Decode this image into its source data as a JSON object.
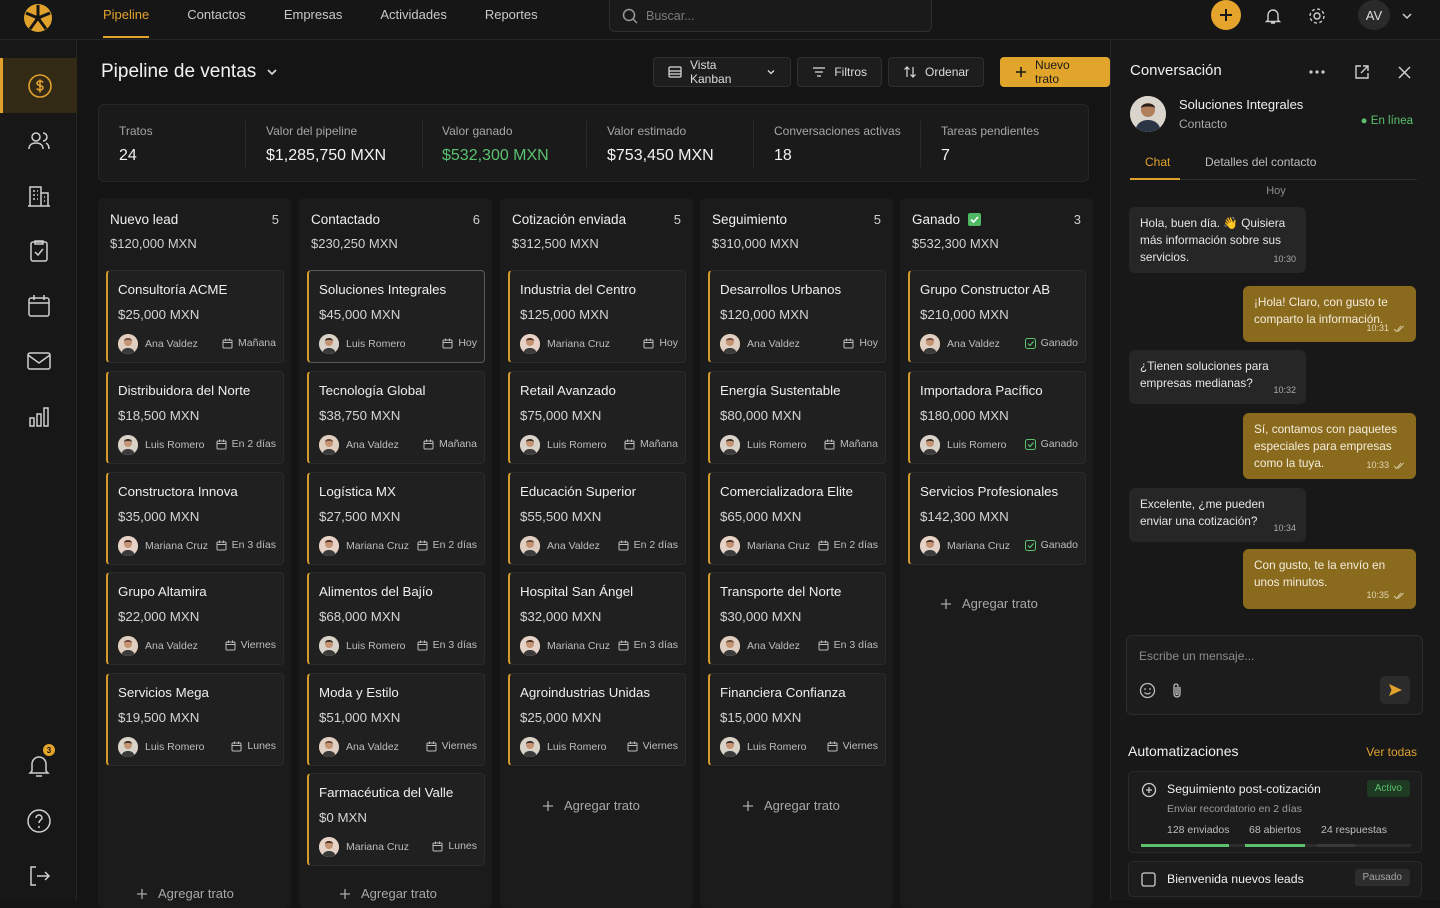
{
  "nav": {
    "tabs": [
      "Pipeline",
      "Contactos",
      "Empresas",
      "Actividades",
      "Reportes"
    ]
  },
  "search": {
    "placeholder": "Buscar..."
  },
  "user": {
    "initials": "AV"
  },
  "sidebar": {
    "notification_count": "3"
  },
  "page": {
    "title": "Pipeline de ventas"
  },
  "toolbar": {
    "view": "Vista Kanban",
    "filters": "Filtros",
    "sort": "Ordenar",
    "new_deal": "Nuevo trato"
  },
  "stats": [
    {
      "label": "Tratos",
      "value": "24"
    },
    {
      "label": "Valor del pipeline",
      "value": "$1,285,750 MXN"
    },
    {
      "label": "Valor ganado",
      "value": "$532,300 MXN",
      "highlight": true
    },
    {
      "label": "Valor estimado",
      "value": "$753,450 MXN"
    },
    {
      "label": "Conversaciones activas",
      "value": "18"
    },
    {
      "label": "Tareas pendientes",
      "value": "7"
    }
  ],
  "add_deal_label": "Agregar trato",
  "columns": [
    {
      "name": "Nuevo lead",
      "count": "5",
      "total": "$120,000 MXN",
      "cards": [
        {
          "title": "Consultoría ACME",
          "amount": "$25,000 MXN",
          "owner": "Ana Valdez",
          "due": "Mañana"
        },
        {
          "title": "Distribuidora del Norte",
          "amount": "$18,500 MXN",
          "owner": "Luis Romero",
          "due": "En 2 días"
        },
        {
          "title": "Constructora Innova",
          "amount": "$35,000 MXN",
          "owner": "Mariana Cruz",
          "due": "En 3 días"
        },
        {
          "title": "Grupo Altamira",
          "amount": "$22,000 MXN",
          "owner": "Ana Valdez",
          "due": "Viernes"
        },
        {
          "title": "Servicios Mega",
          "amount": "$19,500 MXN",
          "owner": "Luis Romero",
          "due": "Lunes"
        }
      ]
    },
    {
      "name": "Contactado",
      "count": "6",
      "total": "$230,250 MXN",
      "cards": [
        {
          "title": "Soluciones Integrales",
          "amount": "$45,000 MXN",
          "owner": "Luis Romero",
          "due": "Hoy",
          "selected": true
        },
        {
          "title": "Tecnología Global",
          "amount": "$38,750 MXN",
          "owner": "Ana Valdez",
          "due": "Mañana"
        },
        {
          "title": "Logística MX",
          "amount": "$27,500 MXN",
          "owner": "Mariana Cruz",
          "due": "En 2 días"
        },
        {
          "title": "Alimentos del Bajío",
          "amount": "$68,000 MXN",
          "owner": "Luis Romero",
          "due": "En 3 días"
        },
        {
          "title": "Moda y Estilo",
          "amount": "$51,000 MXN",
          "owner": "Ana Valdez",
          "due": "Viernes"
        },
        {
          "title": "Farmacéutica del Valle",
          "amount": "$0 MXN",
          "owner": "Mariana Cruz",
          "due": "Lunes"
        }
      ]
    },
    {
      "name": "Cotización enviada",
      "count": "5",
      "total": "$312,500 MXN",
      "cards": [
        {
          "title": "Industria del Centro",
          "amount": "$125,000 MXN",
          "owner": "Mariana Cruz",
          "due": "Hoy"
        },
        {
          "title": "Retail Avanzado",
          "amount": "$75,000 MXN",
          "owner": "Luis Romero",
          "due": "Mañana"
        },
        {
          "title": "Educación Superior",
          "amount": "$55,500 MXN",
          "owner": "Ana Valdez",
          "due": "En 2 días"
        },
        {
          "title": "Hospital San Ángel",
          "amount": "$32,000 MXN",
          "owner": "Mariana Cruz",
          "due": "En 3 días"
        },
        {
          "title": "Agroindustrias Unidas",
          "amount": "$25,000 MXN",
          "owner": "Luis Romero",
          "due": "Viernes"
        }
      ]
    },
    {
      "name": "Seguimiento",
      "count": "5",
      "total": "$310,000 MXN",
      "cards": [
        {
          "title": "Desarrollos Urbanos",
          "amount": "$120,000 MXN",
          "owner": "Ana Valdez",
          "due": "Hoy"
        },
        {
          "title": "Energía Sustentable",
          "amount": "$80,000 MXN",
          "owner": "Luis Romero",
          "due": "Mañana"
        },
        {
          "title": "Comercializadora Elite",
          "amount": "$65,000 MXN",
          "owner": "Mariana Cruz",
          "due": "En 2 días"
        },
        {
          "title": "Transporte del Norte",
          "amount": "$30,000 MXN",
          "owner": "Ana Valdez",
          "due": "En 3 días"
        },
        {
          "title": "Financiera Confianza",
          "amount": "$15,000 MXN",
          "owner": "Luis Romero",
          "due": "Viernes"
        }
      ]
    },
    {
      "name": "Ganado",
      "count": "3",
      "total": "$532,300 MXN",
      "won": true,
      "cards": [
        {
          "title": "Grupo Constructor AB",
          "amount": "$210,000 MXN",
          "owner": "Ana Valdez",
          "due": "Ganado",
          "won": true
        },
        {
          "title": "Importadora Pacífico",
          "amount": "$180,000 MXN",
          "owner": "Luis Romero",
          "due": "Ganado",
          "won": true
        },
        {
          "title": "Servicios Profesionales",
          "amount": "$142,300 MXN",
          "owner": "Mariana Cruz",
          "due": "Ganado",
          "won": true
        }
      ]
    }
  ],
  "conversation": {
    "title": "Conversación",
    "contact_name": "Soluciones Integrales",
    "contact_role": "Contacto",
    "status": "En línea",
    "tabs": [
      "Chat",
      "Detalles del contacto"
    ],
    "day": "Hoy",
    "messages": [
      {
        "dir": "in",
        "text": "Hola, buen día. 👋 Quisiera más información sobre sus servicios.",
        "time": "10:30"
      },
      {
        "dir": "out",
        "text": "¡Hola! Claro, con gusto te comparto la información.",
        "time": "10:31"
      },
      {
        "dir": "in",
        "text": "¿Tienen soluciones para empresas medianas?",
        "time": "10:32"
      },
      {
        "dir": "out",
        "text": "Sí, contamos con paquetes especiales para empresas como la tuya.",
        "time": "10:33"
      },
      {
        "dir": "in",
        "text": "Excelente, ¿me pueden enviar una cotización?",
        "time": "10:34"
      },
      {
        "dir": "out",
        "text": "Con gusto, te la envío en unos minutos.",
        "time": "10:35"
      }
    ],
    "composer_placeholder": "Escribe un mensaje..."
  },
  "automations": {
    "title": "Automatizaciones",
    "see_all": "Ver todas",
    "items": [
      {
        "name": "Seguimiento post-cotización",
        "status": "Activo",
        "desc": "Enviar recordatorio en 2 días",
        "sent": "128 enviados",
        "opened": "68 abiertos",
        "replies": "24 respuestas"
      },
      {
        "name": "Bienvenida nuevos leads",
        "status": "Pausado"
      }
    ]
  },
  "colors": {
    "accent": "#e0a22c",
    "won": "#5bc16f",
    "background": "#141414"
  }
}
